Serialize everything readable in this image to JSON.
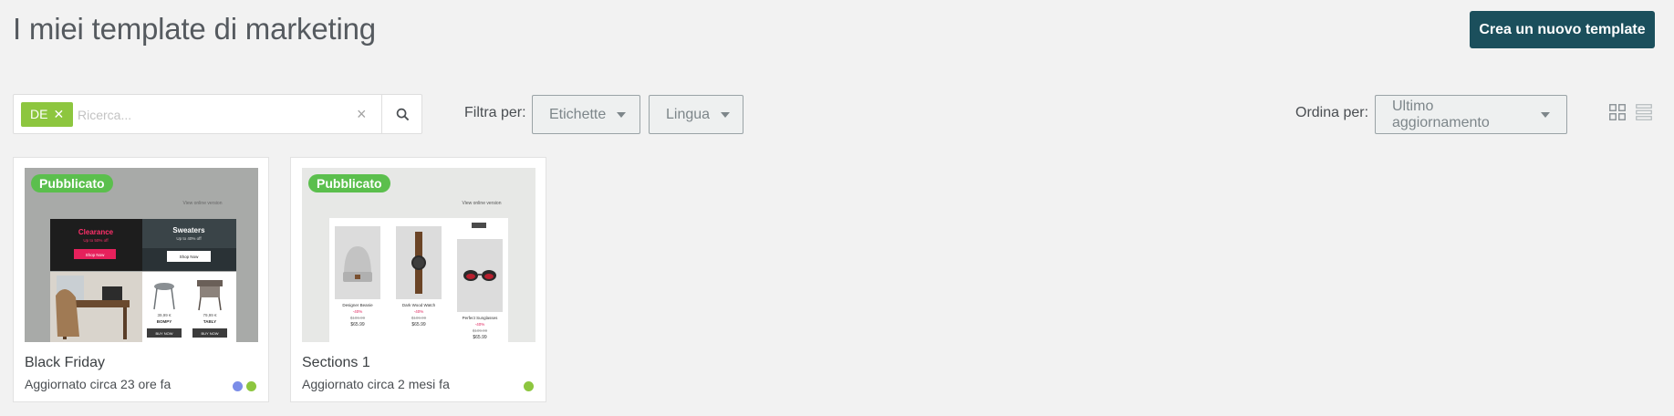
{
  "page": {
    "title": "I miei template di marketing"
  },
  "actions": {
    "create_label": "Crea un nuovo template"
  },
  "search": {
    "tag": "DE",
    "placeholder": "Ricerca..."
  },
  "filters": {
    "label": "Filtra per:",
    "tags_label": "Etichette",
    "language_label": "Lingua"
  },
  "sort": {
    "label": "Ordina per:",
    "value": "Ultimo aggiornamento"
  },
  "colors": {
    "accent": "#1b4f5c",
    "tag_green": "#8dc63f",
    "published_green": "#5bbf4d",
    "lang_blue": "#7b8de8",
    "lang_green": "#8dc63f"
  },
  "cards": [
    {
      "title": "Black Friday",
      "status": "Pubblicato",
      "updated": "Aggiornato circa 23 ore fa",
      "thumb": {
        "view_online": "View online version",
        "promo_left_title": "Clearance",
        "promo_left_sub": "Up to 50% off",
        "promo_left_btn": "Shop Now",
        "promo_right_title": "Sweaters",
        "promo_right_sub": "Up to 40% off",
        "promo_right_btn": "Shop Now",
        "item1_price": "39,99 €",
        "item1_name": "BOMPY",
        "item1_btn": "BUY NOW",
        "item2_price": "79,99 €",
        "item2_name": "TABLY",
        "item2_btn": "BUY NOW"
      }
    },
    {
      "title": "Sections 1",
      "status": "Pubblicato",
      "updated": "Aggiornato circa 2 mesi fa",
      "thumb": {
        "view_online": "View online version",
        "p1_name": "Designer Beanie",
        "p1_disc": "-40%",
        "p1_old": "$109.99",
        "p1_price": "$65.99",
        "p2_name": "Dark Wood Watch",
        "p2_disc": "-40%",
        "p2_old": "$109.99",
        "p2_price": "$65.99",
        "p3_name": "Perfect Sunglasses",
        "p3_disc": "-40%",
        "p3_old": "$109.99",
        "p3_price": "$65.99"
      }
    }
  ]
}
